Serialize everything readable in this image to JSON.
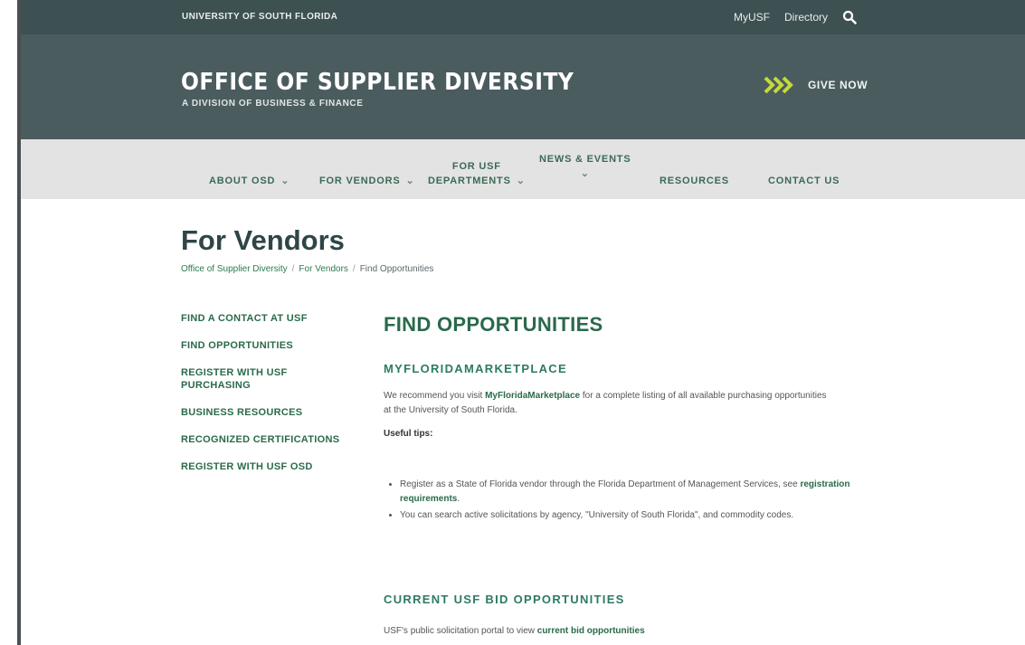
{
  "topbar": {
    "university": "University of South Florida",
    "myusf": "MyUSF",
    "directory": "Directory"
  },
  "header": {
    "title": "Office of Supplier Diversity",
    "subtitle": "A Division of Business & Finance",
    "give_now": "Give Now"
  },
  "nav": {
    "items": [
      {
        "label": "About OSD",
        "caret": "⌄"
      },
      {
        "label": "For Vendors",
        "caret": "⌄"
      },
      {
        "label_line1": "For USF",
        "label_line2": "Departments",
        "caret": "⌄"
      },
      {
        "label_line1": "News & Events",
        "caret": "⌄"
      },
      {
        "label": "Resources"
      },
      {
        "label": "Contact Us"
      }
    ]
  },
  "page": {
    "title": "For Vendors",
    "breadcrumb": [
      "Office of Supplier Diversity",
      "For Vendors",
      "Find Opportunities"
    ],
    "breadcrumb_sep": "/"
  },
  "sidenav": {
    "items": [
      "Find a Contact at USF",
      "Find Opportunities",
      "Register with USF Purchasing",
      "Business Resources",
      "Recognized Certifications",
      "Register with USF OSD"
    ]
  },
  "main": {
    "heading": "Find Opportunities",
    "section1_title": "MyFloridaMarketPlace",
    "intro_before": "We recommend you visit ",
    "intro_link": "MyFloridaMarketplace",
    "intro_after": " for a complete listing of all available purchasing opportunities at the University of South Florida.",
    "tips_label": "Useful tips:",
    "tip1_before": "Register as a State of Florida vendor through the Florida Department of Management Services, see ",
    "tip1_link": "registration requirements",
    "tip1_after": ".",
    "tip2": "You can search active solicitations by agency, \"University of South Florida\", and commodity codes.",
    "section2_title": "Current USF Bid Opportunities",
    "portal_before": "USF's public solicitation portal to view ",
    "portal_link": "current bid opportunities"
  },
  "colors": {
    "topbar": "#3d5052",
    "header": "#4b5c5f",
    "nav_bg": "#e3e3e3",
    "green": "#2a6a4b",
    "chevron": "#c5d93a"
  }
}
